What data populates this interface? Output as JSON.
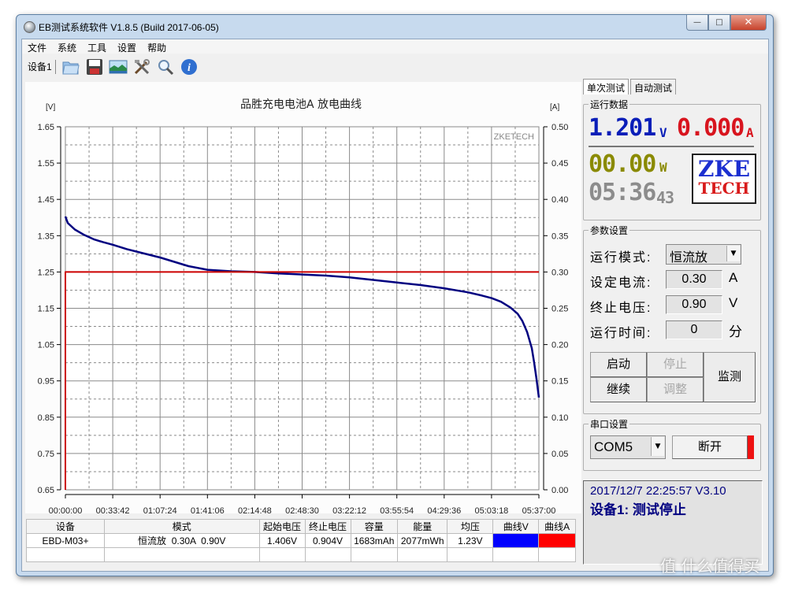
{
  "window": {
    "title": "EB测试系统软件 V1.8.5 (Build 2017-06-05)",
    "min_glyph": "—",
    "max_glyph": "□",
    "close_glyph": "✕"
  },
  "menu": [
    "文件",
    "系统",
    "工具",
    "设置",
    "帮助"
  ],
  "toolbar": {
    "device_tab": "设备1",
    "icons": [
      "open-folder-icon",
      "save-disk-icon",
      "image-icon",
      "tools-icon",
      "search-icon",
      "info-icon"
    ]
  },
  "chart_data": {
    "type": "line",
    "title": "品胜充电电池A 放电曲线",
    "watermark": "ZKETECH",
    "ylabel": "[V]",
    "y2label": "[A]",
    "xlabel": "",
    "ylim": [
      0.65,
      1.65
    ],
    "y2lim": [
      0.0,
      0.5
    ],
    "yticks": [
      "1.65",
      "1.55",
      "1.45",
      "1.35",
      "1.25",
      "1.15",
      "1.05",
      "0.95",
      "0.85",
      "0.75",
      "0.65"
    ],
    "y2ticks": [
      "0.50",
      "0.45",
      "0.40",
      "0.35",
      "0.30",
      "0.25",
      "0.20",
      "0.15",
      "0.10",
      "0.05",
      "0.00"
    ],
    "xticks": [
      "00:00:00",
      "00:33:42",
      "01:07:24",
      "01:41:06",
      "02:14:48",
      "02:48:30",
      "03:22:12",
      "03:55:54",
      "04:29:36",
      "05:03:18",
      "05:37:00"
    ],
    "x_unit": "fraction of 05:37:00",
    "grid": true,
    "series": [
      {
        "name": "曲线V",
        "axis": "left",
        "color": "#000080",
        "x": [
          0,
          0.005,
          0.02,
          0.04,
          0.06,
          0.08,
          0.1,
          0.13,
          0.16,
          0.2,
          0.23,
          0.26,
          0.3,
          0.35,
          0.4,
          0.45,
          0.5,
          0.55,
          0.6,
          0.65,
          0.7,
          0.75,
          0.8,
          0.85,
          0.88,
          0.9,
          0.92,
          0.94,
          0.955,
          0.965,
          0.975,
          0.985,
          0.99,
          0.995,
          1.0
        ],
        "y": [
          1.403,
          1.385,
          1.367,
          1.352,
          1.34,
          1.332,
          1.325,
          1.313,
          1.303,
          1.29,
          1.278,
          1.266,
          1.256,
          1.252,
          1.25,
          1.246,
          1.243,
          1.24,
          1.235,
          1.228,
          1.221,
          1.214,
          1.205,
          1.194,
          1.185,
          1.178,
          1.168,
          1.152,
          1.135,
          1.115,
          1.085,
          1.04,
          1.0,
          0.955,
          0.904
        ]
      },
      {
        "name": "曲线A",
        "axis": "right",
        "color": "#cc0000",
        "x": [
          0,
          0,
          1.0
        ],
        "y": [
          0.0,
          0.3,
          0.3
        ]
      }
    ]
  },
  "table": {
    "headers": [
      "设备",
      "模式",
      "起始电压",
      "终止电压",
      "容量",
      "能量",
      "均压",
      "曲线V",
      "曲线A"
    ],
    "rows": [
      [
        "EBD-M03+",
        "恒流放  0.30A  0.90V",
        "1.406V",
        "0.904V",
        "1683mAh",
        "2077mWh",
        "1.23V",
        "",
        ""
      ]
    ],
    "curve_colors": {
      "v": "#0000ff",
      "a": "#ff0000"
    }
  },
  "right_panel": {
    "tabs": [
      "单次测试",
      "自动测试"
    ],
    "run_data": {
      "label": "运行数据",
      "voltage": "1.201",
      "voltage_unit": "V",
      "current": "0.000",
      "current_unit": "A",
      "power": "00.00",
      "power_unit": "W",
      "time_hm": "05:36",
      "time_s": "43",
      "logo_top": "ZKE",
      "logo_bottom": "TECH"
    },
    "params": {
      "label": "参数设置",
      "mode_label": "运行模式:",
      "mode_value": "恒流放",
      "current_label": "设定电流:",
      "current_value": "0.30",
      "current_unit": "A",
      "cutoff_label": "终止电压:",
      "cutoff_value": "0.90",
      "cutoff_unit": "V",
      "time_label": "运行时间:",
      "time_value": "0",
      "time_unit": "分"
    },
    "buttons": {
      "start": "启动",
      "stop": "停止",
      "continue": "继续",
      "adjust": "调整",
      "monitor": "监测"
    },
    "serial": {
      "label": "串口设置",
      "port": "COM5",
      "disconnect": "断开",
      "indicator_color": "#ee1111"
    },
    "status": {
      "line1": "2017/12/7 22:25:57  V3.10",
      "line2": "设备1: 测试停止"
    }
  },
  "watermark": "值 什么值得买"
}
